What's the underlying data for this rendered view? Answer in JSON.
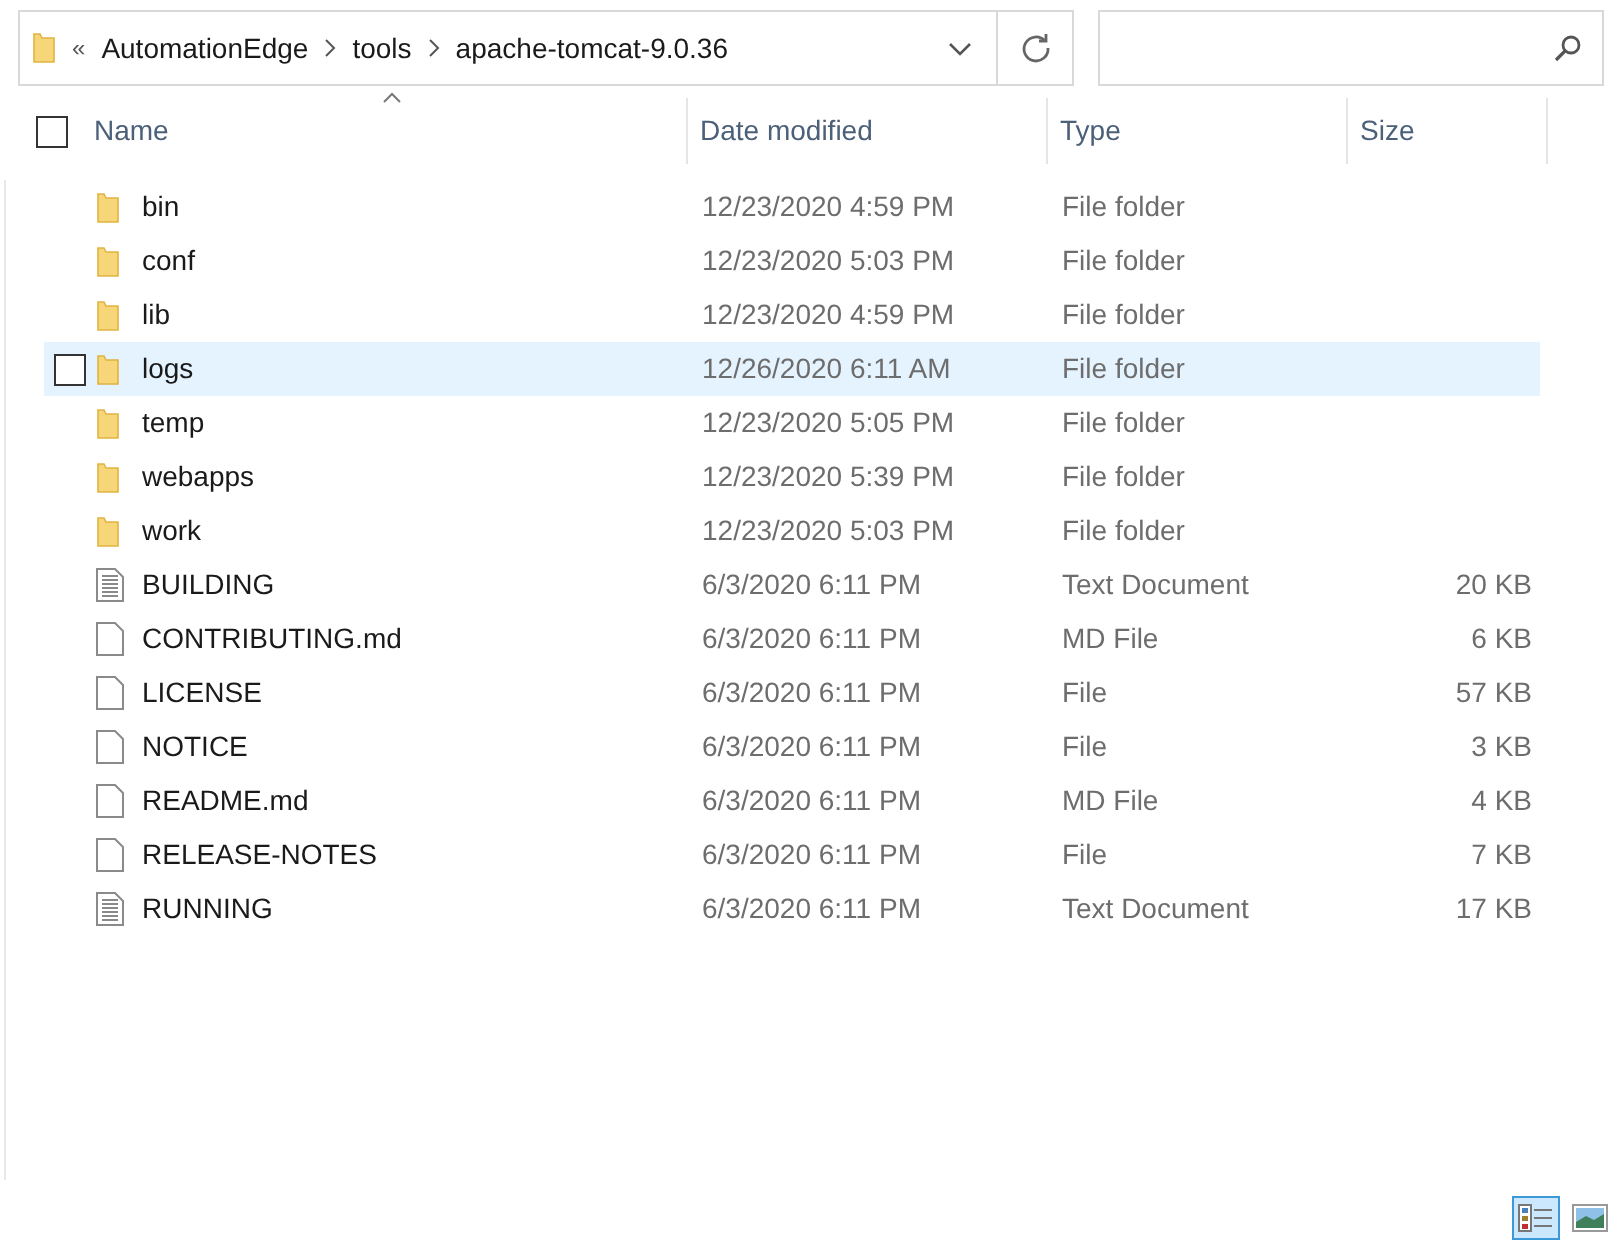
{
  "address_bar": {
    "overflow": "«",
    "crumbs": [
      "AutomationEdge",
      "tools",
      "apache-tomcat-9.0.36"
    ]
  },
  "select_all": {
    "checked": false
  },
  "columns": [
    "Name",
    "Date modified",
    "Type",
    "Size"
  ],
  "rows": [
    {
      "kind": "folder",
      "name": "bin",
      "date": "12/23/2020 4:59 PM",
      "type": "File folder",
      "hovered": false
    },
    {
      "kind": "folder",
      "name": "conf",
      "date": "12/23/2020 5:03 PM",
      "type": "File folder",
      "hovered": false
    },
    {
      "kind": "folder",
      "name": "lib",
      "date": "12/23/2020 4:59 PM",
      "type": "File folder",
      "hovered": false
    },
    {
      "kind": "folder",
      "name": "logs",
      "date": "12/26/2020 6:11 AM",
      "type": "File folder",
      "hovered": true
    },
    {
      "kind": "folder",
      "name": "temp",
      "date": "12/23/2020 5:05 PM",
      "type": "File folder",
      "hovered": false
    },
    {
      "kind": "folder",
      "name": "webapps",
      "date": "12/23/2020 5:39 PM",
      "type": "File folder",
      "hovered": false
    },
    {
      "kind": "folder",
      "name": "work",
      "date": "12/23/2020 5:03 PM",
      "type": "File folder",
      "hovered": false
    },
    {
      "kind": "text",
      "name": "BUILDING",
      "date": "6/3/2020 6:11 PM",
      "type": "Text Document",
      "size": "20 KB",
      "hovered": false
    },
    {
      "kind": "file",
      "name": "CONTRIBUTING.md",
      "date": "6/3/2020 6:11 PM",
      "type": "MD File",
      "size": "6 KB",
      "hovered": false
    },
    {
      "kind": "file",
      "name": "LICENSE",
      "date": "6/3/2020 6:11 PM",
      "type": "File",
      "size": "57 KB",
      "hovered": false
    },
    {
      "kind": "file",
      "name": "NOTICE",
      "date": "6/3/2020 6:11 PM",
      "type": "File",
      "size": "3 KB",
      "hovered": false
    },
    {
      "kind": "file",
      "name": "README.md",
      "date": "6/3/2020 6:11 PM",
      "type": "MD File",
      "size": "4 KB",
      "hovered": false
    },
    {
      "kind": "file",
      "name": "RELEASE-NOTES",
      "date": "6/3/2020 6:11 PM",
      "type": "File",
      "size": "7 KB",
      "hovered": false
    },
    {
      "kind": "text",
      "name": "RUNNING",
      "date": "6/3/2020 6:11 PM",
      "type": "Text Document",
      "size": "17 KB",
      "hovered": false
    }
  ],
  "view_buttons": [
    {
      "kind": "details",
      "selected": true
    },
    {
      "kind": "large_icons",
      "selected": false
    }
  ]
}
